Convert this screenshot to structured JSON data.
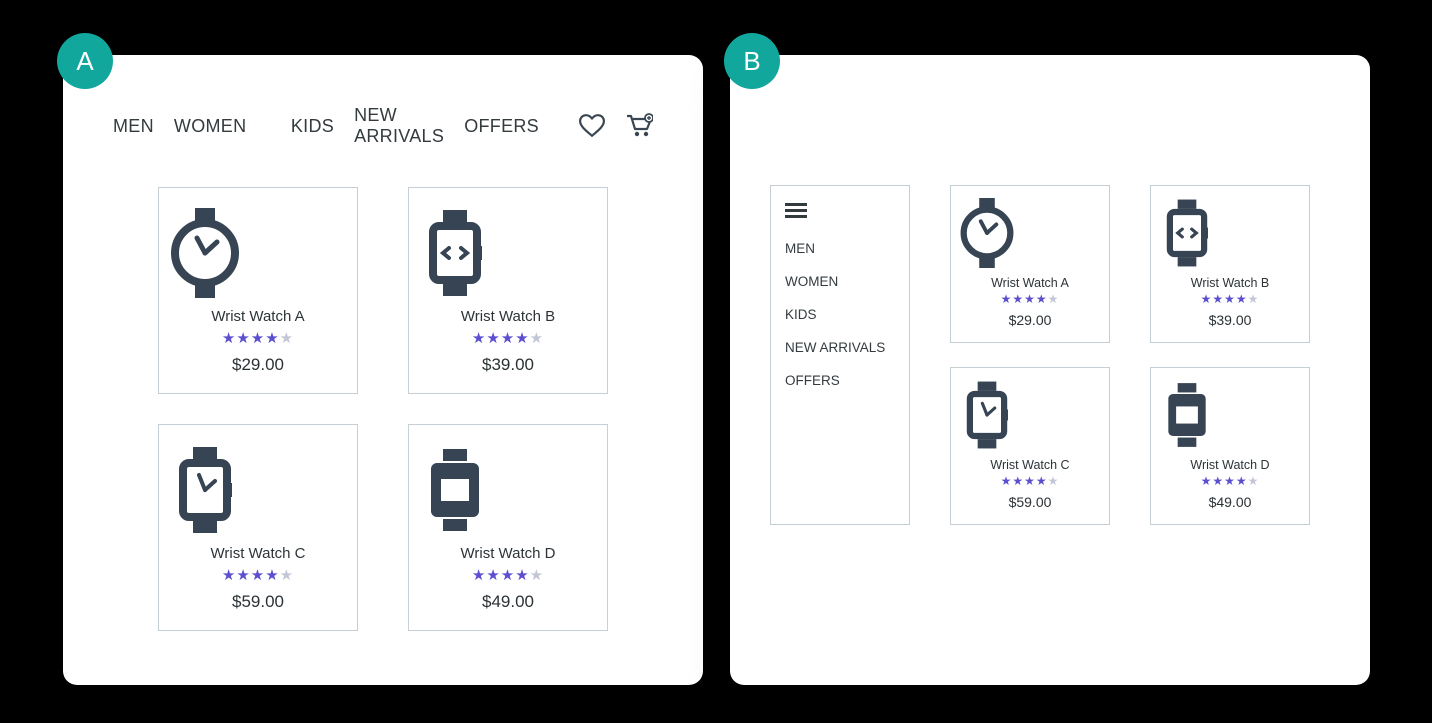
{
  "panels": {
    "a_label": "A",
    "b_label": "B"
  },
  "nav": {
    "items": [
      "MEN",
      "WOMEN",
      "KIDS",
      "NEW ARRIVALS",
      "OFFERS"
    ]
  },
  "products": [
    {
      "name": "Wrist Watch A",
      "price": "$29.00",
      "rating": 4,
      "icon": "watch-round"
    },
    {
      "name": "Wrist Watch B",
      "price": "$39.00",
      "rating": 4,
      "icon": "watch-code"
    },
    {
      "name": "Wrist Watch C",
      "price": "$59.00",
      "rating": 4,
      "icon": "watch-square"
    },
    {
      "name": "Wrist Watch D",
      "price": "$49.00",
      "rating": 4,
      "icon": "watch-solid"
    }
  ]
}
